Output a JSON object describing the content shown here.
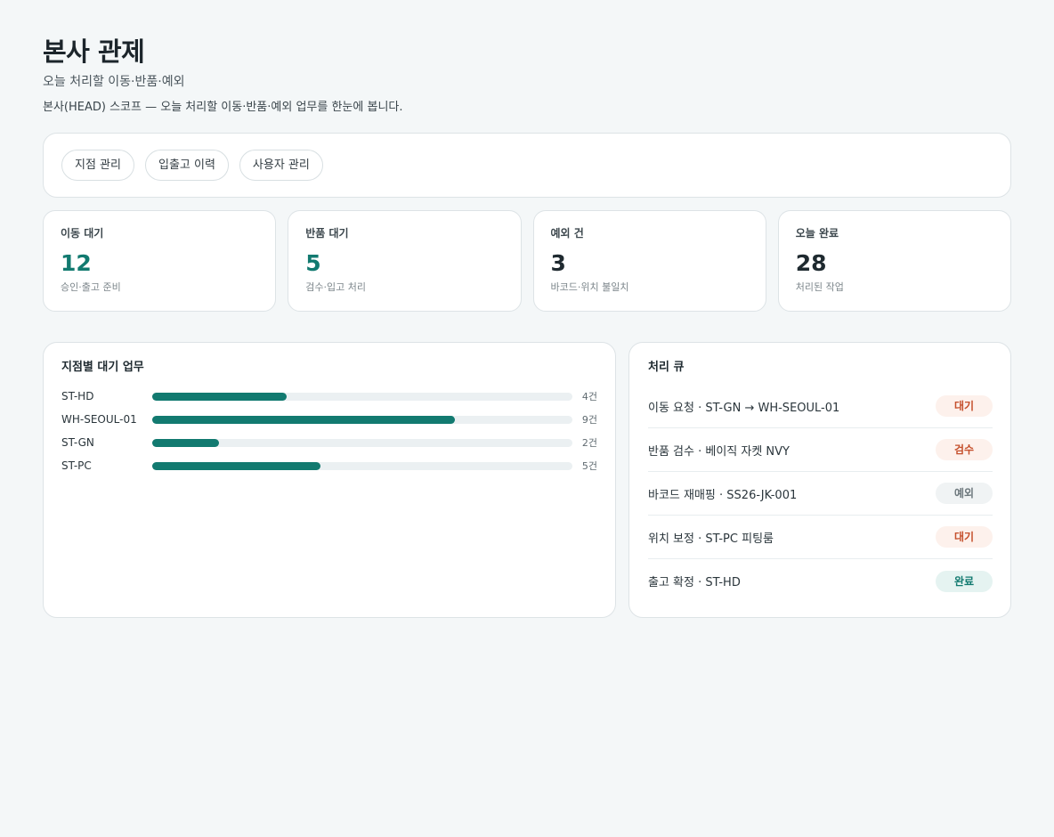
{
  "header": {
    "title": "본사 관제",
    "subtitle": "오늘 처리할 이동·반품·예외",
    "description": "본사(HEAD) 스코프 — 오늘 처리할 이동·반품·예외 업무를 한눈에 봅니다."
  },
  "nav": {
    "items": [
      {
        "label": "지점 관리"
      },
      {
        "label": "입출고 이력"
      },
      {
        "label": "사용자 관리"
      }
    ]
  },
  "stats": [
    {
      "label": "이동 대기",
      "value": "12",
      "hint": "승인·출고 준비"
    },
    {
      "label": "반품 대기",
      "value": "5",
      "hint": "검수·입고 처리"
    },
    {
      "label": "예외 건",
      "value": "3",
      "hint": "바코드·위치 불일치"
    },
    {
      "label": "오늘 완료",
      "value": "28",
      "hint": "처리된 작업"
    }
  ],
  "branches": {
    "title": "지점별 대기 업무",
    "max": 12.5,
    "rows": [
      {
        "name": "ST-HD",
        "value": 4,
        "count_label": "4건"
      },
      {
        "name": "WH-SEOUL-01",
        "value": 9,
        "count_label": "9건"
      },
      {
        "name": "ST-GN",
        "value": 2,
        "count_label": "2건"
      },
      {
        "name": "ST-PC",
        "value": 5,
        "count_label": "5건"
      }
    ]
  },
  "queue": {
    "title": "처리 큐",
    "items": [
      {
        "text": "이동 요청 · ST-GN → WH-SEOUL-01",
        "status": "대기",
        "kind": "wait"
      },
      {
        "text": "반품 검수 · 베이직 자켓 NVY",
        "status": "검수",
        "kind": "check"
      },
      {
        "text": "바코드 재매핑 · SS26-JK-001",
        "status": "예외",
        "kind": "exception"
      },
      {
        "text": "위치 보정 · ST-PC 피팅룸",
        "status": "대기",
        "kind": "wait"
      },
      {
        "text": "출고 확정 · ST-HD",
        "status": "완료",
        "kind": "done"
      }
    ]
  }
}
